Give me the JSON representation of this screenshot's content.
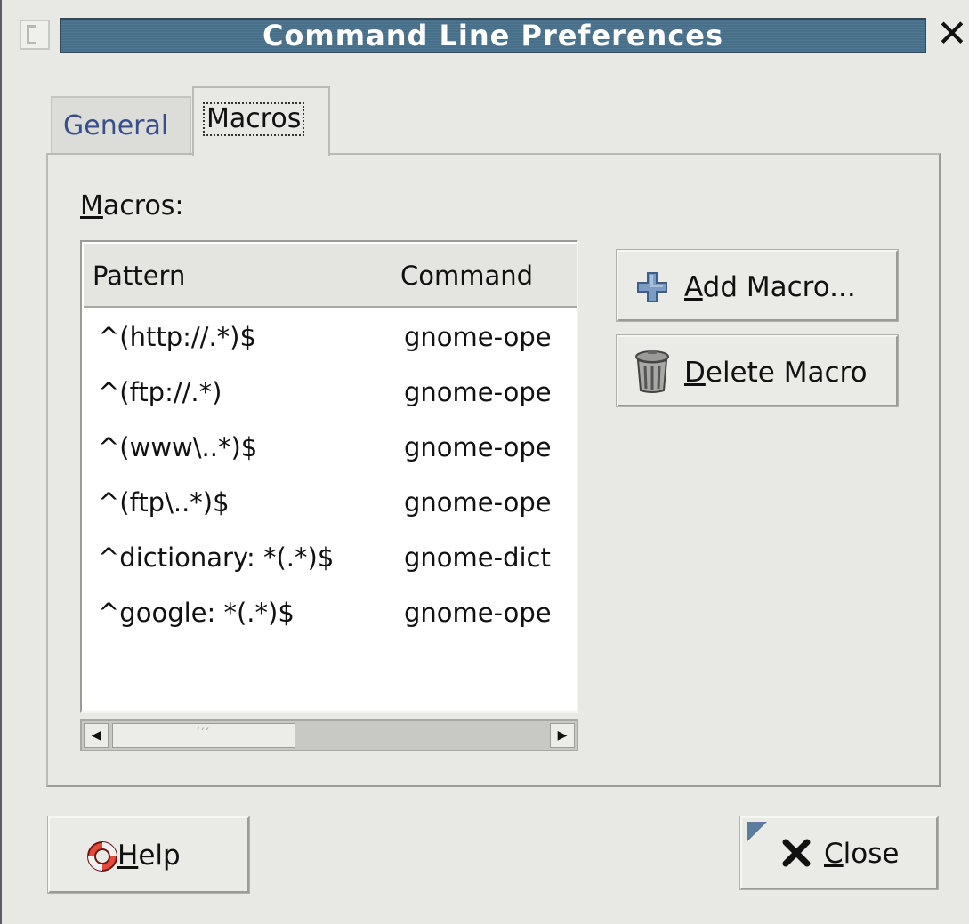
{
  "window": {
    "title": "Command Line Preferences"
  },
  "tabs": [
    {
      "label": "General",
      "active": false
    },
    {
      "label": "Macros",
      "active": true
    }
  ],
  "macros": {
    "label_underlined": "M",
    "label_rest": "acros:",
    "columns": [
      "Pattern",
      "Command"
    ],
    "rows": [
      {
        "pattern": "^(http://.*)$",
        "command": "gnome-ope"
      },
      {
        "pattern": "^(ftp://.*)",
        "command": "gnome-ope"
      },
      {
        "pattern": "^(www\\..*)$",
        "command": "gnome-ope"
      },
      {
        "pattern": "^(ftp\\..*)$",
        "command": "gnome-ope"
      },
      {
        "pattern": "^dictionary: *(.*)$",
        "command": "gnome-dict"
      },
      {
        "pattern": "^google: *(.*)$",
        "command": "gnome-ope"
      }
    ],
    "scrollbar_grip": "′′′"
  },
  "buttons": {
    "add_macro": {
      "underlined": "A",
      "rest": "dd Macro..."
    },
    "delete_macro": {
      "underlined": "D",
      "rest": "elete Macro"
    },
    "help": {
      "underlined": "H",
      "rest": "elp"
    },
    "close": {
      "underlined": "C",
      "rest": "lose"
    }
  },
  "icons": {
    "window_close": "✕",
    "scroll_left": "◀",
    "scroll_right": "▶"
  },
  "colors": {
    "titlebar": "#486f8a",
    "tab_text": "#3a4f8a",
    "background": "#e8e8e4"
  }
}
